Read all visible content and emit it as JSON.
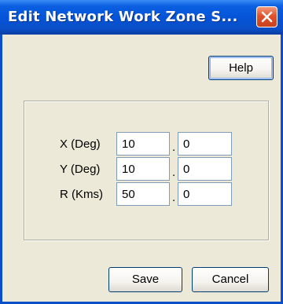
{
  "window": {
    "title": "Edit Network Work Zone S...",
    "close_icon": "close-icon"
  },
  "toolbar": {
    "help_label": "Help"
  },
  "fields": {
    "x": {
      "label": "X (Deg)",
      "int_value": "10",
      "dec_value": "0"
    },
    "y": {
      "label": "Y (Deg)",
      "int_value": "10",
      "dec_value": "0"
    },
    "r": {
      "label": "R (Kms)",
      "int_value": "50",
      "dec_value": "0"
    },
    "separator": "."
  },
  "footer": {
    "save_label": "Save",
    "cancel_label": "Cancel"
  },
  "colors": {
    "titlebar": "#0553d6",
    "dialog_background": "#ece9d8",
    "close_button": "#e0512b",
    "button_border": "#003c74",
    "input_border": "#7f9db9"
  }
}
